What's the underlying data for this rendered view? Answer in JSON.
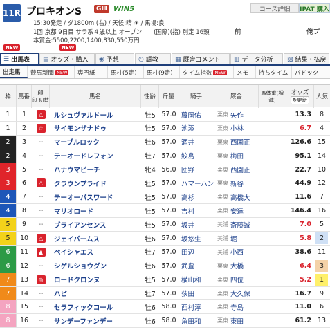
{
  "header": {
    "race_no": "11R",
    "race_name": "プロキオンS",
    "grade": "GⅢ",
    "win5": "WIN5",
    "course_btn": "コース詳細",
    "ipat_btn": "IPAT 購入",
    "prev": "前",
    "next": "俺プ",
    "line1": "15:30発走 / ダ1800m (右) / 天候:晴 ☀ / 馬場:良",
    "line2": "1回 京都 9日目 サラ系４歳以上 オープン　　(国際)(指) 別定 16頭",
    "line3": "本賞金:5500,2200,1400,830,550万円"
  },
  "colors": {
    "waku": [
      "#ffffff",
      "#222222",
      "#e0242a",
      "#1d56b8",
      "#f3d21a",
      "#2c9a46",
      "#f08a1a",
      "#f4a4c0"
    ]
  },
  "tabs": [
    {
      "label": "出馬表",
      "icon": "list-icon"
    },
    {
      "label": "オッズ・購入",
      "icon": "ticket-icon"
    },
    {
      "label": "予想",
      "icon": "tipster-icon"
    },
    {
      "label": "調教",
      "icon": "clock-icon"
    },
    {
      "label": "厩舎コメント",
      "icon": "comment-icon"
    },
    {
      "label": "データ分析",
      "icon": "chart-icon"
    },
    {
      "label": "結果・払戻",
      "icon": "result-icon"
    }
  ],
  "subtabs": [
    "出走馬",
    "競馬新聞",
    "専門紙",
    "馬柱(5走)",
    "馬柱(9走)",
    "タイム指数",
    "メモ",
    "持ちタイム",
    "パドック"
  ],
  "columns": [
    "枠",
    "馬番",
    "印",
    "馬名",
    "性齢",
    "斤量",
    "騎手",
    "厩舎",
    "馬体重(増減)",
    "オッズ",
    "人気"
  ],
  "columns_sub": {
    "mark": "印 切替",
    "odds_btn": "更新"
  },
  "rows": [
    {
      "waku": 1,
      "num": "1",
      "mark": "△",
      "name": "ルシュヴァルドール",
      "sex": "牡5",
      "wt": "57.0",
      "jockey": "藤岡佑",
      "aff": "栗東",
      "trainer": "矢作",
      "odds": "13.3",
      "pop": "8"
    },
    {
      "waku": 1,
      "num": "2",
      "mark": "☆",
      "name": "サイモンザナドゥ",
      "sex": "牡5",
      "wt": "57.0",
      "jockey": "池添",
      "aff": "栗東",
      "trainer": "小林",
      "odds": "6.7",
      "pop": "4"
    },
    {
      "waku": 2,
      "num": "3",
      "mark": "--",
      "name": "マーブルロック",
      "sex": "牡6",
      "wt": "57.0",
      "jockey": "酒井",
      "aff": "栗東",
      "trainer": "西園正",
      "odds": "126.6",
      "pop": "15"
    },
    {
      "waku": 2,
      "num": "4",
      "mark": "--",
      "name": "テーオードレフォン",
      "sex": "牡7",
      "wt": "57.0",
      "jockey": "鮫島",
      "aff": "栗東",
      "trainer": "梅田",
      "odds": "95.1",
      "pop": "14"
    },
    {
      "waku": 3,
      "num": "5",
      "mark": "--",
      "name": "ハナウマビーチ",
      "sex": "牝4",
      "wt": "56.0",
      "jockey": "団野",
      "aff": "栗東",
      "trainer": "西園正",
      "odds": "22.7",
      "pop": "10"
    },
    {
      "waku": 3,
      "num": "6",
      "mark": "△",
      "name": "クラウンプライド",
      "sex": "牡5",
      "wt": "57.0",
      "jockey": "ハマーハン",
      "aff": "栗東",
      "trainer": "新谷",
      "odds": "44.9",
      "pop": "12"
    },
    {
      "waku": 4,
      "num": "7",
      "mark": "--",
      "name": "テーオーパスワード",
      "sex": "牡5",
      "wt": "57.0",
      "jockey": "高杉",
      "aff": "栗東",
      "trainer": "高橋大",
      "odds": "11.6",
      "pop": "7"
    },
    {
      "waku": 4,
      "num": "8",
      "mark": "--",
      "name": "マリオロード",
      "sex": "牡5",
      "wt": "57.0",
      "jockey": "吉村",
      "aff": "栗東",
      "trainer": "安達",
      "odds": "146.4",
      "pop": "16"
    },
    {
      "waku": 5,
      "num": "9",
      "mark": "--",
      "name": "ブライアンセンス",
      "sex": "牡5",
      "wt": "57.0",
      "jockey": "坂井",
      "aff": "美浦",
      "trainer": "斎藤誠",
      "odds": "7.0",
      "pop": "5"
    },
    {
      "waku": 5,
      "num": "10",
      "mark": "△",
      "name": "ジェイパームス",
      "sex": "牡6",
      "wt": "57.0",
      "jockey": "坂悠生",
      "aff": "美浦",
      "trainer": "堀",
      "odds": "5.8",
      "pop": "2"
    },
    {
      "waku": 6,
      "num": "11",
      "mark": "▲",
      "name": "ペイシャエス",
      "sex": "牡7",
      "wt": "57.0",
      "jockey": "田辺",
      "aff": "美浦",
      "trainer": "小西",
      "odds": "38.6",
      "pop": "11"
    },
    {
      "waku": 6,
      "num": "12",
      "mark": "--",
      "name": "シゲルショウグン",
      "sex": "牡6",
      "wt": "57.0",
      "jockey": "武豊",
      "aff": "栗東",
      "trainer": "大橋",
      "odds": "6.4",
      "pop": "3"
    },
    {
      "waku": 7,
      "num": "13",
      "mark": "◎",
      "name": "ロードクロンヌ",
      "sex": "牡5",
      "wt": "57.0",
      "jockey": "横山和",
      "aff": "栗東",
      "trainer": "四位",
      "odds": "5.2",
      "pop": "1"
    },
    {
      "waku": 7,
      "num": "14",
      "mark": "--",
      "name": "ハピ",
      "sex": "牡7",
      "wt": "57.0",
      "jockey": "荻田",
      "aff": "栗東",
      "trainer": "大久保",
      "odds": "16.7",
      "pop": "9"
    },
    {
      "waku": 8,
      "num": "15",
      "mark": "--",
      "name": "セラフィックコール",
      "sex": "牡6",
      "wt": "58.0",
      "jockey": "西村淳",
      "aff": "栗東",
      "trainer": "寺島",
      "odds": "11.0",
      "pop": "6"
    },
    {
      "waku": 8,
      "num": "16",
      "mark": "--",
      "name": "サンデーファンデー",
      "sex": "牡6",
      "wt": "58.0",
      "jockey": "角田和",
      "aff": "栗東",
      "trainer": "東田",
      "odds": "61.2",
      "pop": "13"
    }
  ]
}
